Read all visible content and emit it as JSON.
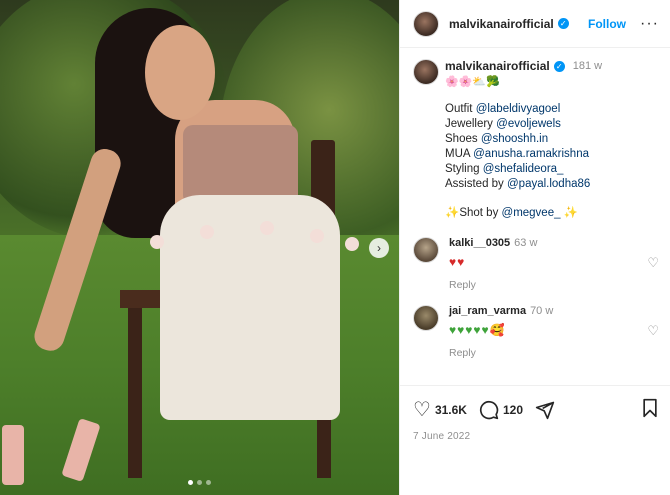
{
  "post": {
    "username": "malvikanairofficial",
    "follow_label": "Follow",
    "more_label": "···",
    "carousel_next": "›"
  },
  "caption": {
    "username": "malvikanairofficial",
    "time": "181 w",
    "emoji": "🌸🌸⛅🥦",
    "lines": [
      {
        "label": "Outfit ",
        "mention": "@labeldivyagoel"
      },
      {
        "label": "Jewellery ",
        "mention": "@evoljewels"
      },
      {
        "label": "Shoes ",
        "mention": "@shooshh.in"
      },
      {
        "label": "MUA ",
        "mention": "@anusha.ramakrishna"
      },
      {
        "label": "Styling ",
        "mention": "@shefalideora_"
      },
      {
        "label": "Assisted by ",
        "mention": "@payal.lodha86"
      }
    ],
    "shot_prefix": "✨Shot by ",
    "shot_mention": "@megvee_",
    "shot_suffix": " ✨"
  },
  "comments": [
    {
      "username": "kalki__0305",
      "time": "63 w",
      "text": "♥♥",
      "reply": "Reply"
    },
    {
      "username": "jai_ram_varma",
      "time": "70 w",
      "text": "♥♥♥♥♥🥰",
      "reply": "Reply"
    }
  ],
  "actions": {
    "likes": "31.6K",
    "comments": "120",
    "date": "7 June 2022"
  },
  "colors": {
    "accent": "#0095f6",
    "mention": "#00376b",
    "muted": "#8e8e8e",
    "red_hearts": "#d62a2a",
    "green_hearts": "#3ea33a"
  }
}
